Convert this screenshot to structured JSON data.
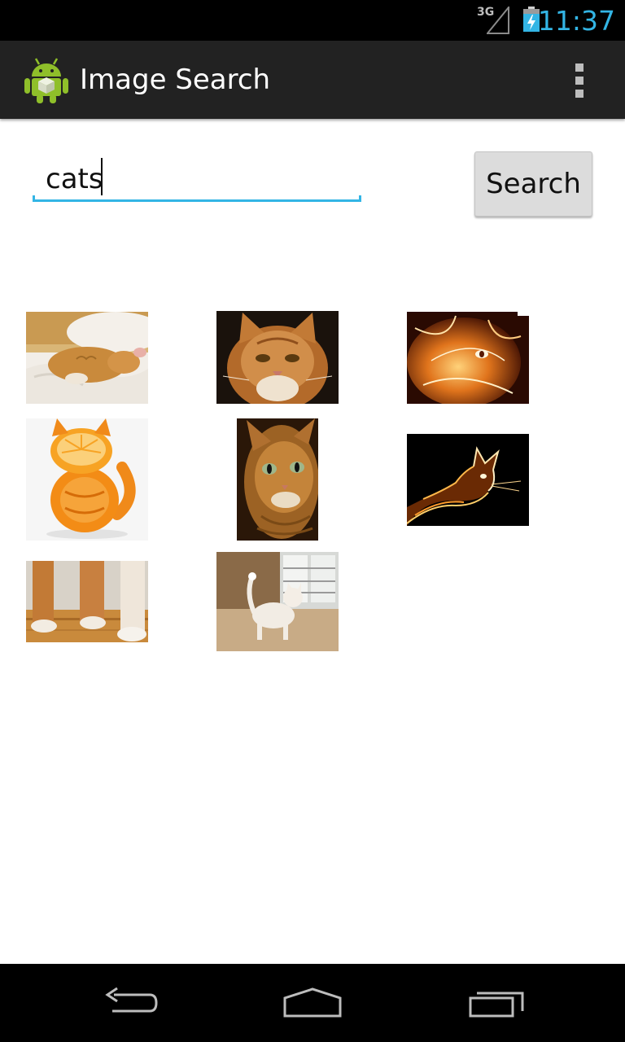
{
  "status_bar": {
    "network": "3G",
    "time": "11:37",
    "time_color": "#33b5e5"
  },
  "action_bar": {
    "title": "Image Search",
    "app_icon": "android-icon",
    "overflow_icon": "overflow-menu-icon"
  },
  "search": {
    "query": "cats",
    "button_label": "Search",
    "accent_color": "#33b5e5"
  },
  "results": [
    {
      "name": "cat-sleeping-on-bed"
    },
    {
      "name": "orange-cat-face"
    },
    {
      "name": "fractal-fire-cat-face"
    },
    {
      "name": "orange-fruit-cat"
    },
    {
      "name": "cat-looking-up"
    },
    {
      "name": "fractal-fire-cat-profile"
    },
    {
      "name": "cat-paws-on-floor"
    },
    {
      "name": "white-cat-at-window"
    }
  ],
  "nav_bar": {
    "back_icon": "back-icon",
    "home_icon": "home-icon",
    "recents_icon": "recent-apps-icon"
  }
}
